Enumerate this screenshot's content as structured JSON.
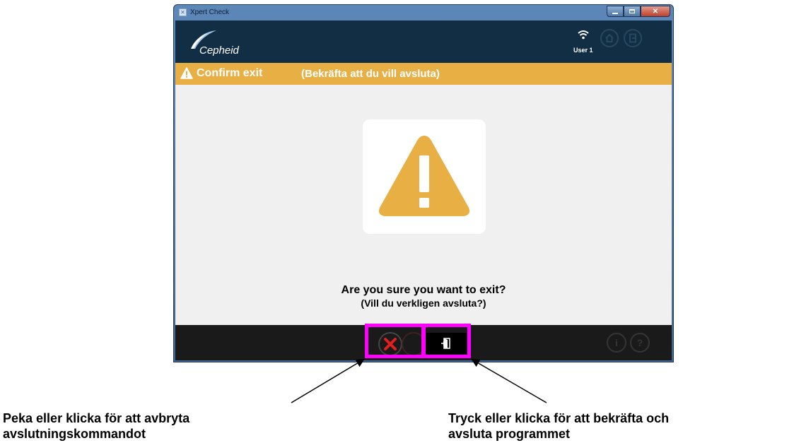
{
  "window": {
    "title": "Xpert Check",
    "buttons": [
      "minimize",
      "maximize",
      "close"
    ]
  },
  "header": {
    "logo_text": "Cepheid",
    "user_label": "User 1",
    "icons": [
      "wifi-icon",
      "home-icon",
      "exit-icon"
    ]
  },
  "dialog": {
    "title": "Confirm exit",
    "title_sub": "(Bekräfta att du vill avsluta)",
    "question": "Are you sure you want to exit?",
    "question_sub": "(Vill du verkligen avsluta?)",
    "colors": {
      "accent": "#e8af45",
      "header_bg": "#112e44",
      "cancel_red": "#e02020",
      "highlight": "#ff00ff"
    }
  },
  "bottom_bar": {
    "buttons": [
      "cancel-x-icon",
      "confirm-exit-icon",
      "info-icon",
      "help-icon"
    ],
    "info_glyph": "i",
    "help_glyph": "?"
  },
  "annotations": {
    "left_line1": "Peka eller klicka för att avbryta",
    "left_line2": "avslutningskommandot",
    "right_line1": "Tryck eller klicka för att bekräfta och",
    "right_line2": "avsluta programmet"
  }
}
